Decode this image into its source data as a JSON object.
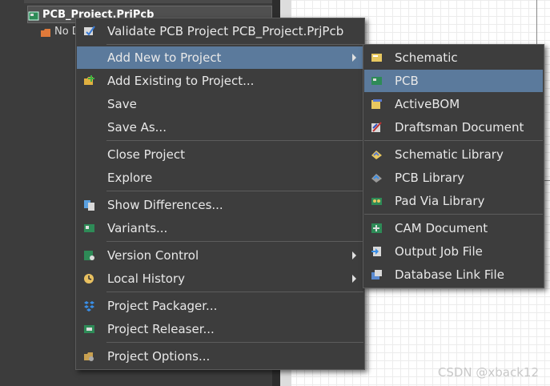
{
  "tree": {
    "project_label": "PCB_Project.PrjPcb",
    "folder_label": "No D"
  },
  "context_menu": {
    "validate": "Validate PCB Project PCB_Project.PrjPcb",
    "add_new": "Add New to Project",
    "add_existing": "Add Existing to Project...",
    "save": "Save",
    "save_as": "Save As...",
    "close_project": "Close Project",
    "explore": "Explore",
    "show_differences": "Show Differences...",
    "variants": "Variants...",
    "version_control": "Version Control",
    "local_history": "Local History",
    "project_packager": "Project Packager...",
    "project_releaser": "Project Releaser...",
    "project_options": "Project Options..."
  },
  "submenu": {
    "schematic": "Schematic",
    "pcb": "PCB",
    "activebom": "ActiveBOM",
    "draftsman": "Draftsman Document",
    "schematic_library": "Schematic Library",
    "pcb_library": "PCB Library",
    "pad_via_library": "Pad Via Library",
    "cam_document": "CAM Document",
    "output_job": "Output Job File",
    "database_link": "Database Link File"
  },
  "watermark": "CSDN @xback12",
  "colors": {
    "menu_bg": "#3d3d3d",
    "highlight": "#5b7a9c",
    "text": "#e8e8e8"
  }
}
